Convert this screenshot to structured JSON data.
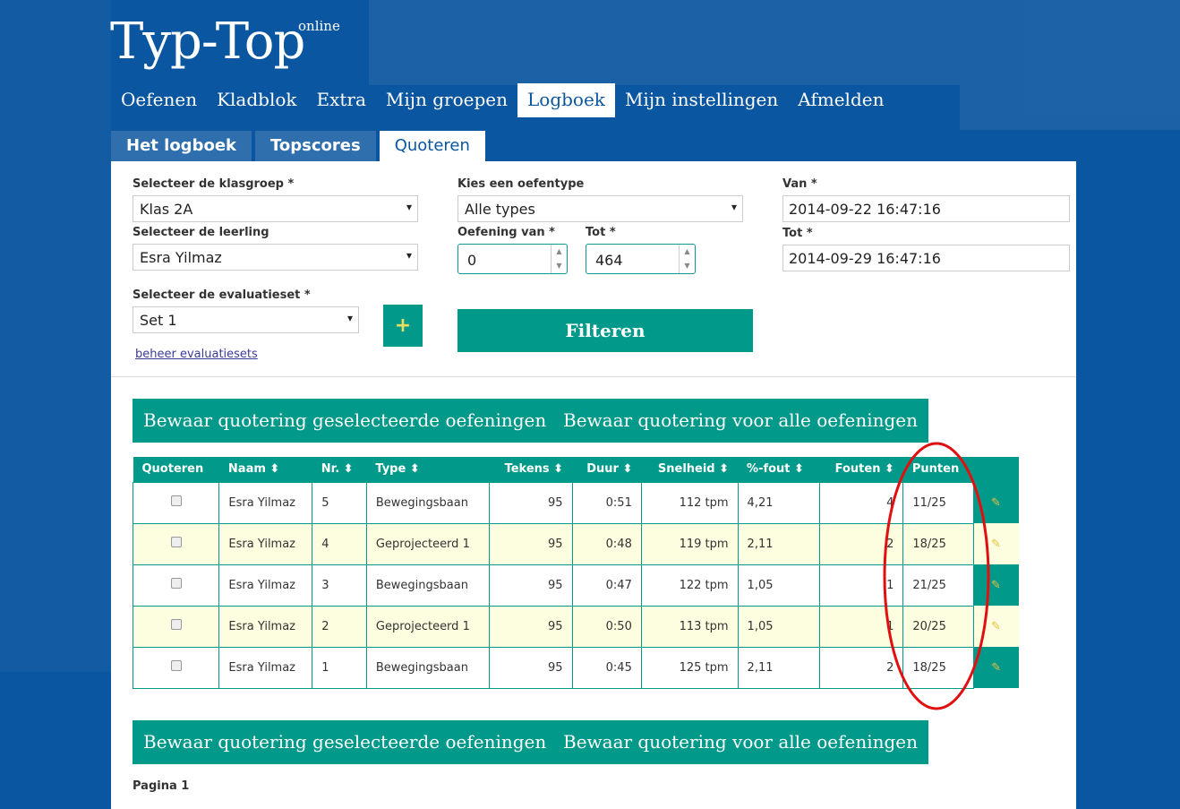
{
  "header": {
    "logo": "Typ-Top",
    "logo_sup": "online"
  },
  "nav": [
    "Oefenen",
    "Kladblok",
    "Extra",
    "Mijn groepen",
    "Logboek",
    "Mijn instellingen",
    "Afmelden"
  ],
  "nav_active": "Logboek",
  "subtabs": [
    "Het logboek",
    "Topscores",
    "Quoteren"
  ],
  "subtab_active": "Quoteren",
  "filters": {
    "klasgroep_label": "Selecteer de klasgroep *",
    "klasgroep": "Klas 2A",
    "leerling_label": "Selecteer de leerling",
    "leerling": "Esra Yilmaz",
    "evalset_label": "Selecteer de evaluatieset *",
    "evalset": "Set 1",
    "add_icon": "plus-icon",
    "beheer_link": "beheer evaluatiesets",
    "oefentype_label": "Kies een oefentype",
    "oefentype": "Alle types",
    "oefening_van_label": "Oefening van *",
    "oefening_van": "0",
    "tot_num_label": "Tot *",
    "tot_num": "464",
    "filter_button": "Filteren",
    "van_label": "Van *",
    "van": "2014-09-22 16:47:16",
    "tot_label": "Tot *",
    "tot": "2014-09-29 16:47:16"
  },
  "actions": {
    "save_selected": "Bewaar quotering geselecteerde oefeningen",
    "save_all": "Bewaar quotering voor alle oefeningen"
  },
  "table": {
    "headers": [
      "Quoteren",
      "Naam",
      "Nr.",
      "Type",
      "Tekens",
      "Duur",
      "Snelheid",
      "%-fout",
      "Fouten",
      "Punten"
    ],
    "rows": [
      [
        "Esra Yilmaz",
        "5",
        "Bewegingsbaan",
        "95",
        "0:51",
        "112 tpm",
        "4,21",
        "4",
        "11/25"
      ],
      [
        "Esra Yilmaz",
        "4",
        "Geprojecteerd 1",
        "95",
        "0:48",
        "119 tpm",
        "2,11",
        "2",
        "18/25"
      ],
      [
        "Esra Yilmaz",
        "3",
        "Bewegingsbaan",
        "95",
        "0:47",
        "122 tpm",
        "1,05",
        "1",
        "21/25"
      ],
      [
        "Esra Yilmaz",
        "2",
        "Geprojecteerd 1",
        "95",
        "0:50",
        "113 tpm",
        "1,05",
        "1",
        "20/25"
      ],
      [
        "Esra Yilmaz",
        "1",
        "Bewegingsbaan",
        "95",
        "0:45",
        "125 tpm",
        "2,11",
        "2",
        "18/25"
      ]
    ]
  },
  "pagination": "Pagina 1",
  "colors": {
    "brand_blue": "#0a56a0",
    "teal": "#00998a",
    "row_alt": "#fdfde0",
    "annotation": "#e01010"
  }
}
